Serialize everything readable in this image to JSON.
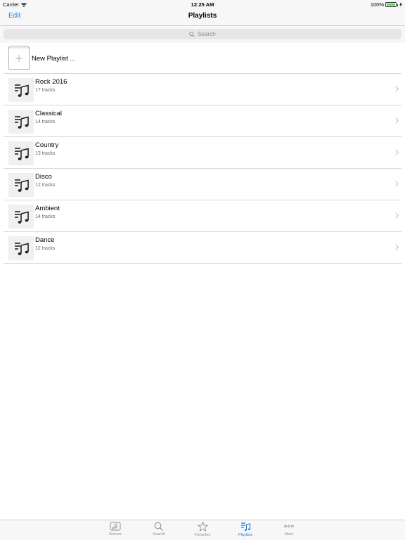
{
  "status": {
    "carrier": "Carrier",
    "time": "12:25 AM",
    "battery": "100%",
    "battery_level": 1.0
  },
  "nav": {
    "edit_label": "Edit",
    "title": "Playlists"
  },
  "search": {
    "placeholder": "Search",
    "icon": "search-icon"
  },
  "new_playlist": {
    "label": "New Playlist ...",
    "icon": "plus-icon"
  },
  "playlists": [
    {
      "title": "Rock 2016",
      "tracks": "17 tracks"
    },
    {
      "title": "Classical",
      "tracks": "14 tracks"
    },
    {
      "title": "Country",
      "tracks": "13 tracks"
    },
    {
      "title": "Disco",
      "tracks": "12 tracks"
    },
    {
      "title": "Ambient",
      "tracks": "14 tracks"
    },
    {
      "title": "Dance",
      "tracks": "12 tracks"
    }
  ],
  "tabs": [
    {
      "label": "Genres",
      "icon": "genres-icon",
      "active": false
    },
    {
      "label": "Search",
      "icon": "search-icon",
      "active": false
    },
    {
      "label": "Favorites",
      "icon": "star-icon",
      "active": false
    },
    {
      "label": "Playlists",
      "icon": "playlist-icon",
      "active": true
    },
    {
      "label": "More",
      "icon": "more-icon",
      "active": false
    }
  ],
  "colors": {
    "accent": "#1a7ee0",
    "battery": "#4cd964",
    "inactive": "#8e8e93"
  }
}
